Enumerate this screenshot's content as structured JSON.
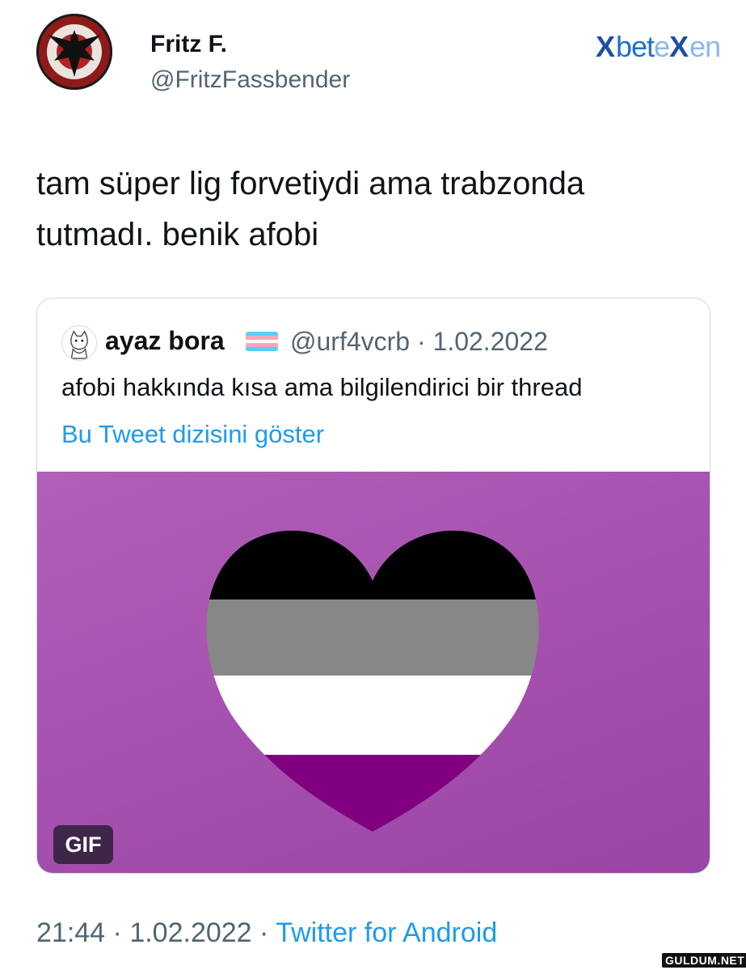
{
  "tweet": {
    "author_name": "Fritz F.",
    "author_handle": "@FritzFassbender",
    "text": "tam süper lig forvetiydi ama trabzonda\ntutmadı. benik afobi",
    "time": "21:44",
    "sep1": "·",
    "date": "1.02.2022",
    "sep2": "·",
    "source": "Twitter for Android"
  },
  "logo": {
    "mark": "X",
    "word_a": "bet",
    "word_b": "e",
    "word_c": "X",
    "word_d": "en"
  },
  "quote": {
    "author_name": "ayaz bora",
    "flag_icon": "transgender-flag-icon",
    "author_handle": "@urf4vcrb",
    "separator": "·",
    "date": "1.02.2022",
    "text": "afobi hakkında kısa ama bilgilendirici bir thread",
    "show_thread_link": "Bu Tweet dizisini göster",
    "media_badge": "GIF"
  },
  "watermark": "GULDUM.NET",
  "colors": {
    "link": "#1d9bf0",
    "secondary_text": "#536471",
    "media_bg": "#a752b0",
    "flag_black": "#000000",
    "flag_gray": "#a3a3a3",
    "flag_white": "#ffffff",
    "flag_purple": "#800080",
    "trans_blue": "#5bcefa",
    "trans_pink": "#f5a9b8"
  }
}
